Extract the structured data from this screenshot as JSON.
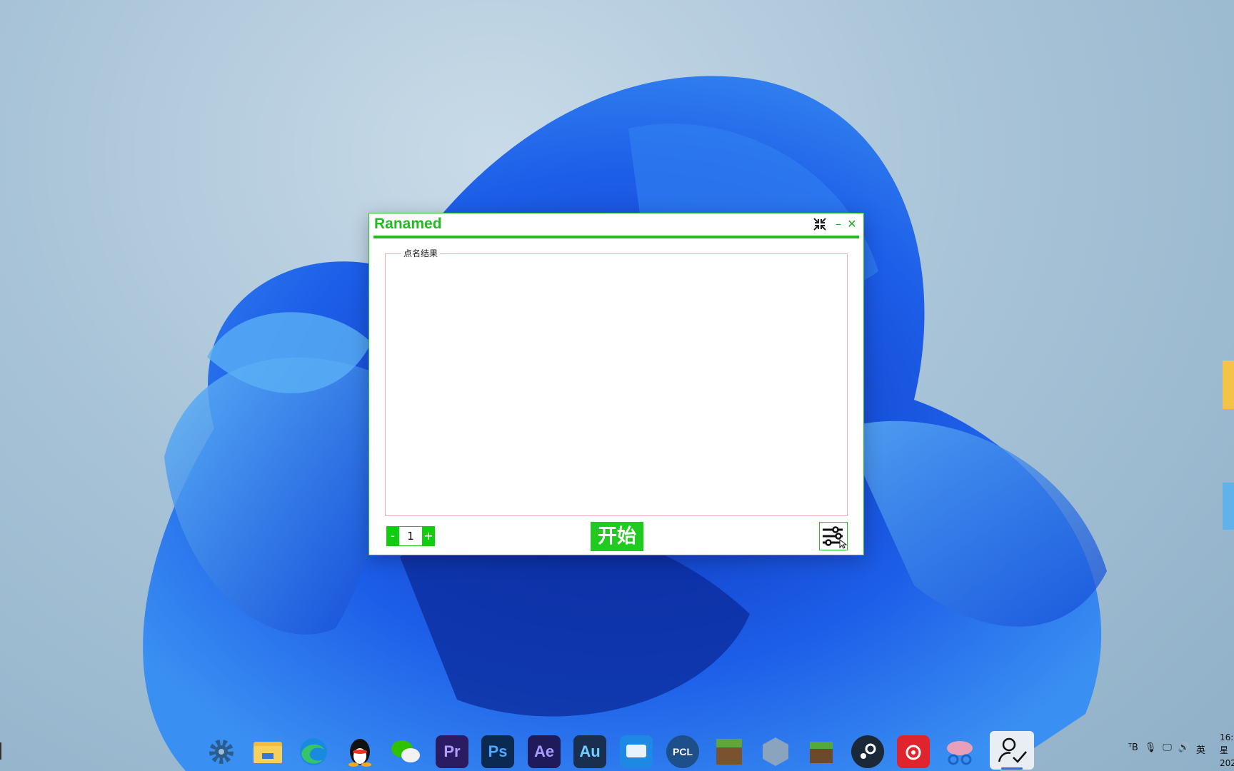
{
  "window": {
    "title": "Ranamed",
    "result_group_label": "点名结果",
    "count_value": "1",
    "minus_label": "-",
    "plus_label": "+",
    "start_label": "开始"
  },
  "tray": {
    "ime": "英",
    "time_partial": "16:",
    "date_partial": "星",
    "year_partial": "202"
  },
  "taskbar": {
    "app_labels": {
      "premiere": "Pr",
      "photoshop": "Ps",
      "aftereffects": "Ae",
      "audition": "Au",
      "pcl": "PCL"
    }
  },
  "colors": {
    "accent": "#22bb22",
    "button_fill": "#1ecb1e"
  }
}
